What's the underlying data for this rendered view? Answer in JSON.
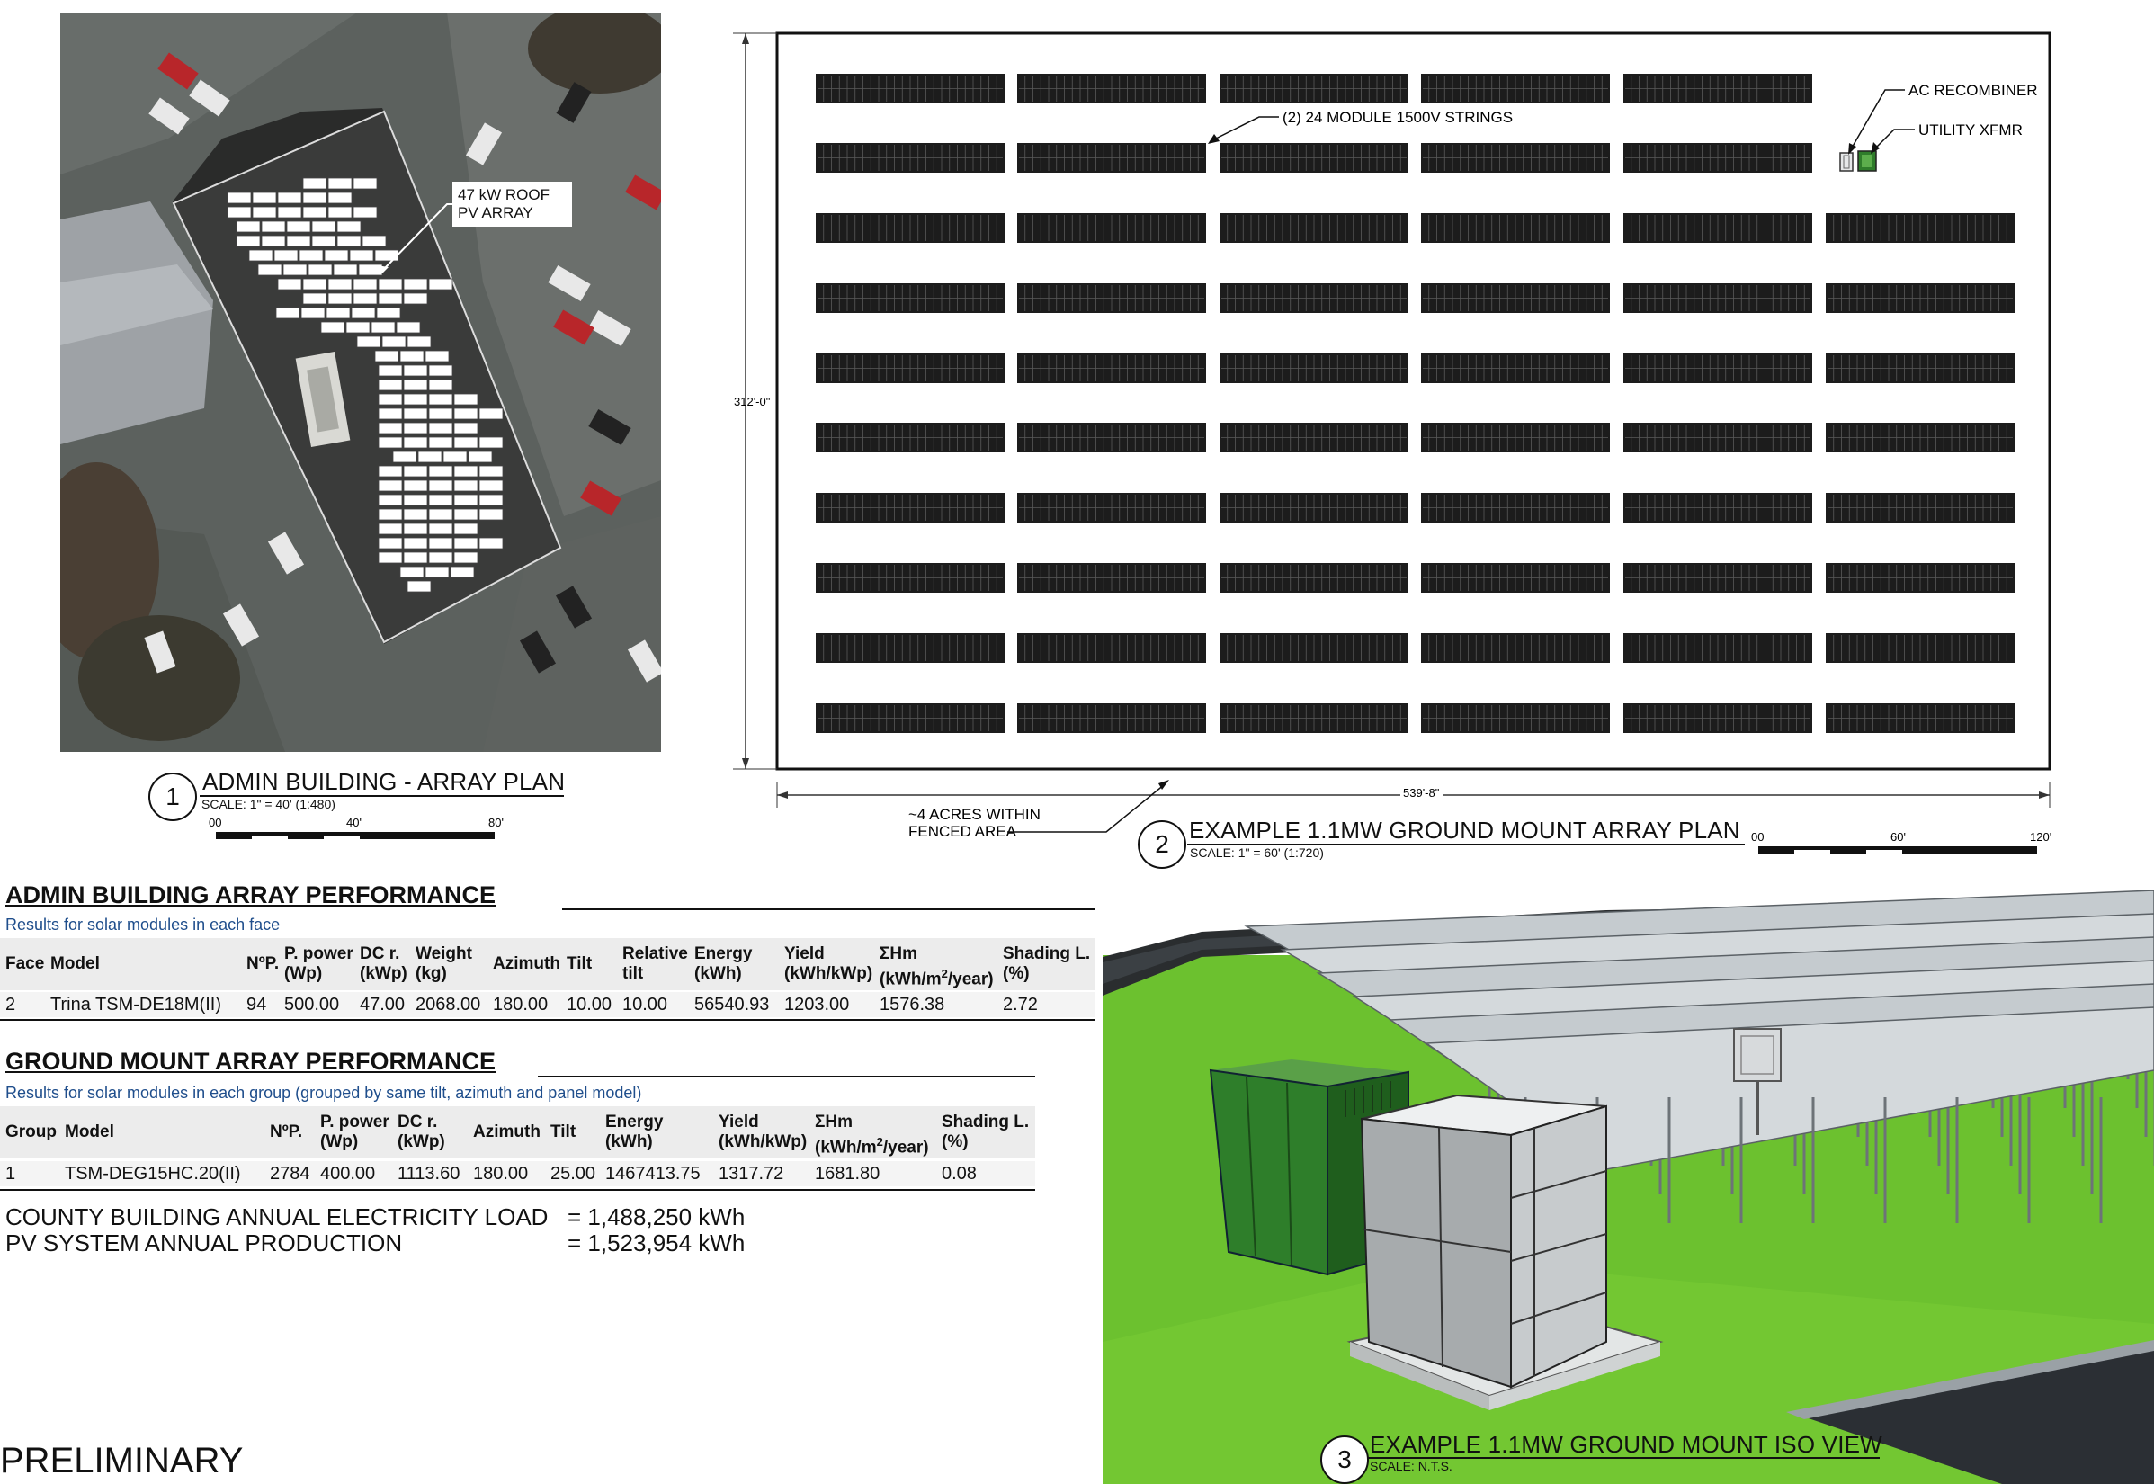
{
  "view1": {
    "number": "1",
    "title": "ADMIN BUILDING - ARRAY PLAN",
    "scale": "SCALE: 1\" = 40'  (1:480)",
    "bar_ticks": [
      "00",
      "40'",
      "80'"
    ],
    "callout": "47 kW ROOF\nPV ARRAY"
  },
  "view2": {
    "number": "2",
    "title": "EXAMPLE 1.1MW GROUND MOUNT ARRAY PLAN",
    "scale": "SCALE: 1\" = 60'  (1:720)",
    "bar_ticks": [
      "00",
      "60'",
      "120'"
    ],
    "dim_vertical": "312'-0\"",
    "dim_horizontal": "539'-8\"",
    "callout_strings": "(2) 24 MODULE 1500V STRINGS",
    "callout_recombiner": "AC RECOMBINER",
    "callout_xfmr": "UTILITY XFMR",
    "callout_fence": "~4 ACRES WITHIN\nFENCED AREA"
  },
  "view3": {
    "number": "3",
    "title": "EXAMPLE 1.1MW GROUND MOUNT ISO VIEW",
    "scale": "SCALE: N.T.S."
  },
  "admin_table": {
    "title": "ADMIN BUILDING ARRAY PERFORMANCE",
    "subtitle": "Results for solar modules in each face",
    "headers": [
      {
        "l1": "Face",
        "l2": ""
      },
      {
        "l1": "Model",
        "l2": ""
      },
      {
        "l1": "NºP.",
        "l2": ""
      },
      {
        "l1": "P. power",
        "l2": "(Wp)"
      },
      {
        "l1": "DC r.",
        "l2": "(kWp)"
      },
      {
        "l1": "Weight",
        "l2": "(kg)"
      },
      {
        "l1": "Azimuth",
        "l2": ""
      },
      {
        "l1": "Tilt",
        "l2": ""
      },
      {
        "l1": "Relative",
        "l2": "tilt"
      },
      {
        "l1": "Energy",
        "l2": "(kWh)"
      },
      {
        "l1": "Yield",
        "l2": "(kWh/kWp)"
      },
      {
        "l1": "ΣHm",
        "l2": "(kWh/m2/year)"
      },
      {
        "l1": "Shading L.",
        "l2": "(%)"
      }
    ],
    "row": [
      "2",
      "Trina TSM-DE18M(II)",
      "94",
      "500.00",
      "47.00",
      "2068.00",
      "180.00",
      "10.00",
      "10.00",
      "56540.93",
      "1203.00",
      "1576.38",
      "2.72"
    ]
  },
  "ground_table": {
    "title": "GROUND MOUNT ARRAY PERFORMANCE",
    "subtitle": "Results for solar modules in each group (grouped by same tilt, azimuth and panel model)",
    "headers": [
      {
        "l1": "Group",
        "l2": ""
      },
      {
        "l1": "Model",
        "l2": ""
      },
      {
        "l1": "NºP.",
        "l2": ""
      },
      {
        "l1": "P. power",
        "l2": "(Wp)"
      },
      {
        "l1": "DC r.",
        "l2": "(kWp)"
      },
      {
        "l1": "Azimuth",
        "l2": ""
      },
      {
        "l1": "Tilt",
        "l2": ""
      },
      {
        "l1": "Energy",
        "l2": "(kWh)"
      },
      {
        "l1": "Yield",
        "l2": "(kWh/kWp)"
      },
      {
        "l1": "ΣHm",
        "l2": "(kWh/m2/year)"
      },
      {
        "l1": "Shading L.",
        "l2": "(%)"
      }
    ],
    "row": [
      "1",
      "TSM-DEG15HC.20(II)",
      "2784",
      "400.00",
      "1113.60",
      "180.00",
      "25.00",
      "1467413.75",
      "1317.72",
      "1681.80",
      "0.08"
    ]
  },
  "summary": {
    "load_label": "COUNTY BUILDING ANNUAL ELECTRICITY LOAD",
    "load_value": "= 1,488,250 kWh",
    "prod_label": "PV SYSTEM ANNUAL PRODUCTION",
    "prod_value": "= 1,523,954 kWh"
  },
  "stamp": "PRELIMINARY",
  "colors": {
    "module": "#1c1c1c",
    "grass": "#6cc12f",
    "transformer": "#2f7d2b",
    "recombiner": "#bfc4c7",
    "link_blue": "#1f4e8c"
  }
}
